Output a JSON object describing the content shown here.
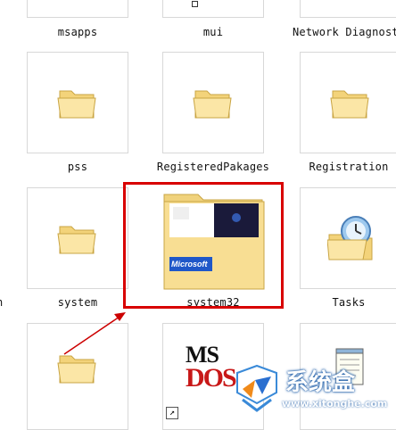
{
  "folders": {
    "row0": [
      "msapps",
      "mui",
      "Network Diagnost"
    ],
    "row1": [
      "pss",
      "RegisteredPakages",
      "Registration"
    ],
    "row2": [
      "system",
      "system32",
      "Tasks"
    ]
  },
  "edge_left_fragment": "n",
  "system32_tile": {
    "brand_label": "Microsoft"
  },
  "msdos_icon": {
    "line1": "MS",
    "line2": "DOS"
  },
  "shortcut_glyph": "↗",
  "watermark": {
    "brand": "系统盒",
    "url": "www.xitonghe.com"
  },
  "colors": {
    "highlight_border": "#d80000",
    "arrow": "#cc0000",
    "folder_fill": "#f5d98a"
  }
}
